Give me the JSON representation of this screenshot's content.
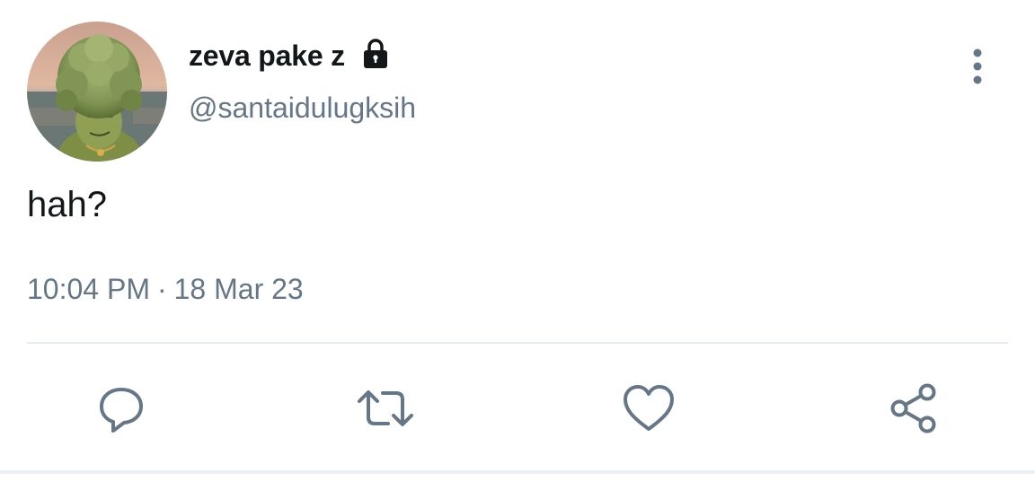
{
  "tweet": {
    "display_name": "zeva pake z",
    "handle": "@santaidulugksih",
    "text": "hah?",
    "time": "10:04 PM",
    "separator": "·",
    "date": "18 Mar 23",
    "protected_icon": "lock-icon",
    "avatar": "broccoli-character-avatar"
  },
  "actions": [
    {
      "icon": "reply-icon"
    },
    {
      "icon": "retweet-icon"
    },
    {
      "icon": "like-icon"
    },
    {
      "icon": "share-icon"
    }
  ],
  "colors": {
    "text_primary": "#14171a",
    "text_secondary": "#657786",
    "icon": "#657786",
    "divider": "#e6ecf0"
  }
}
